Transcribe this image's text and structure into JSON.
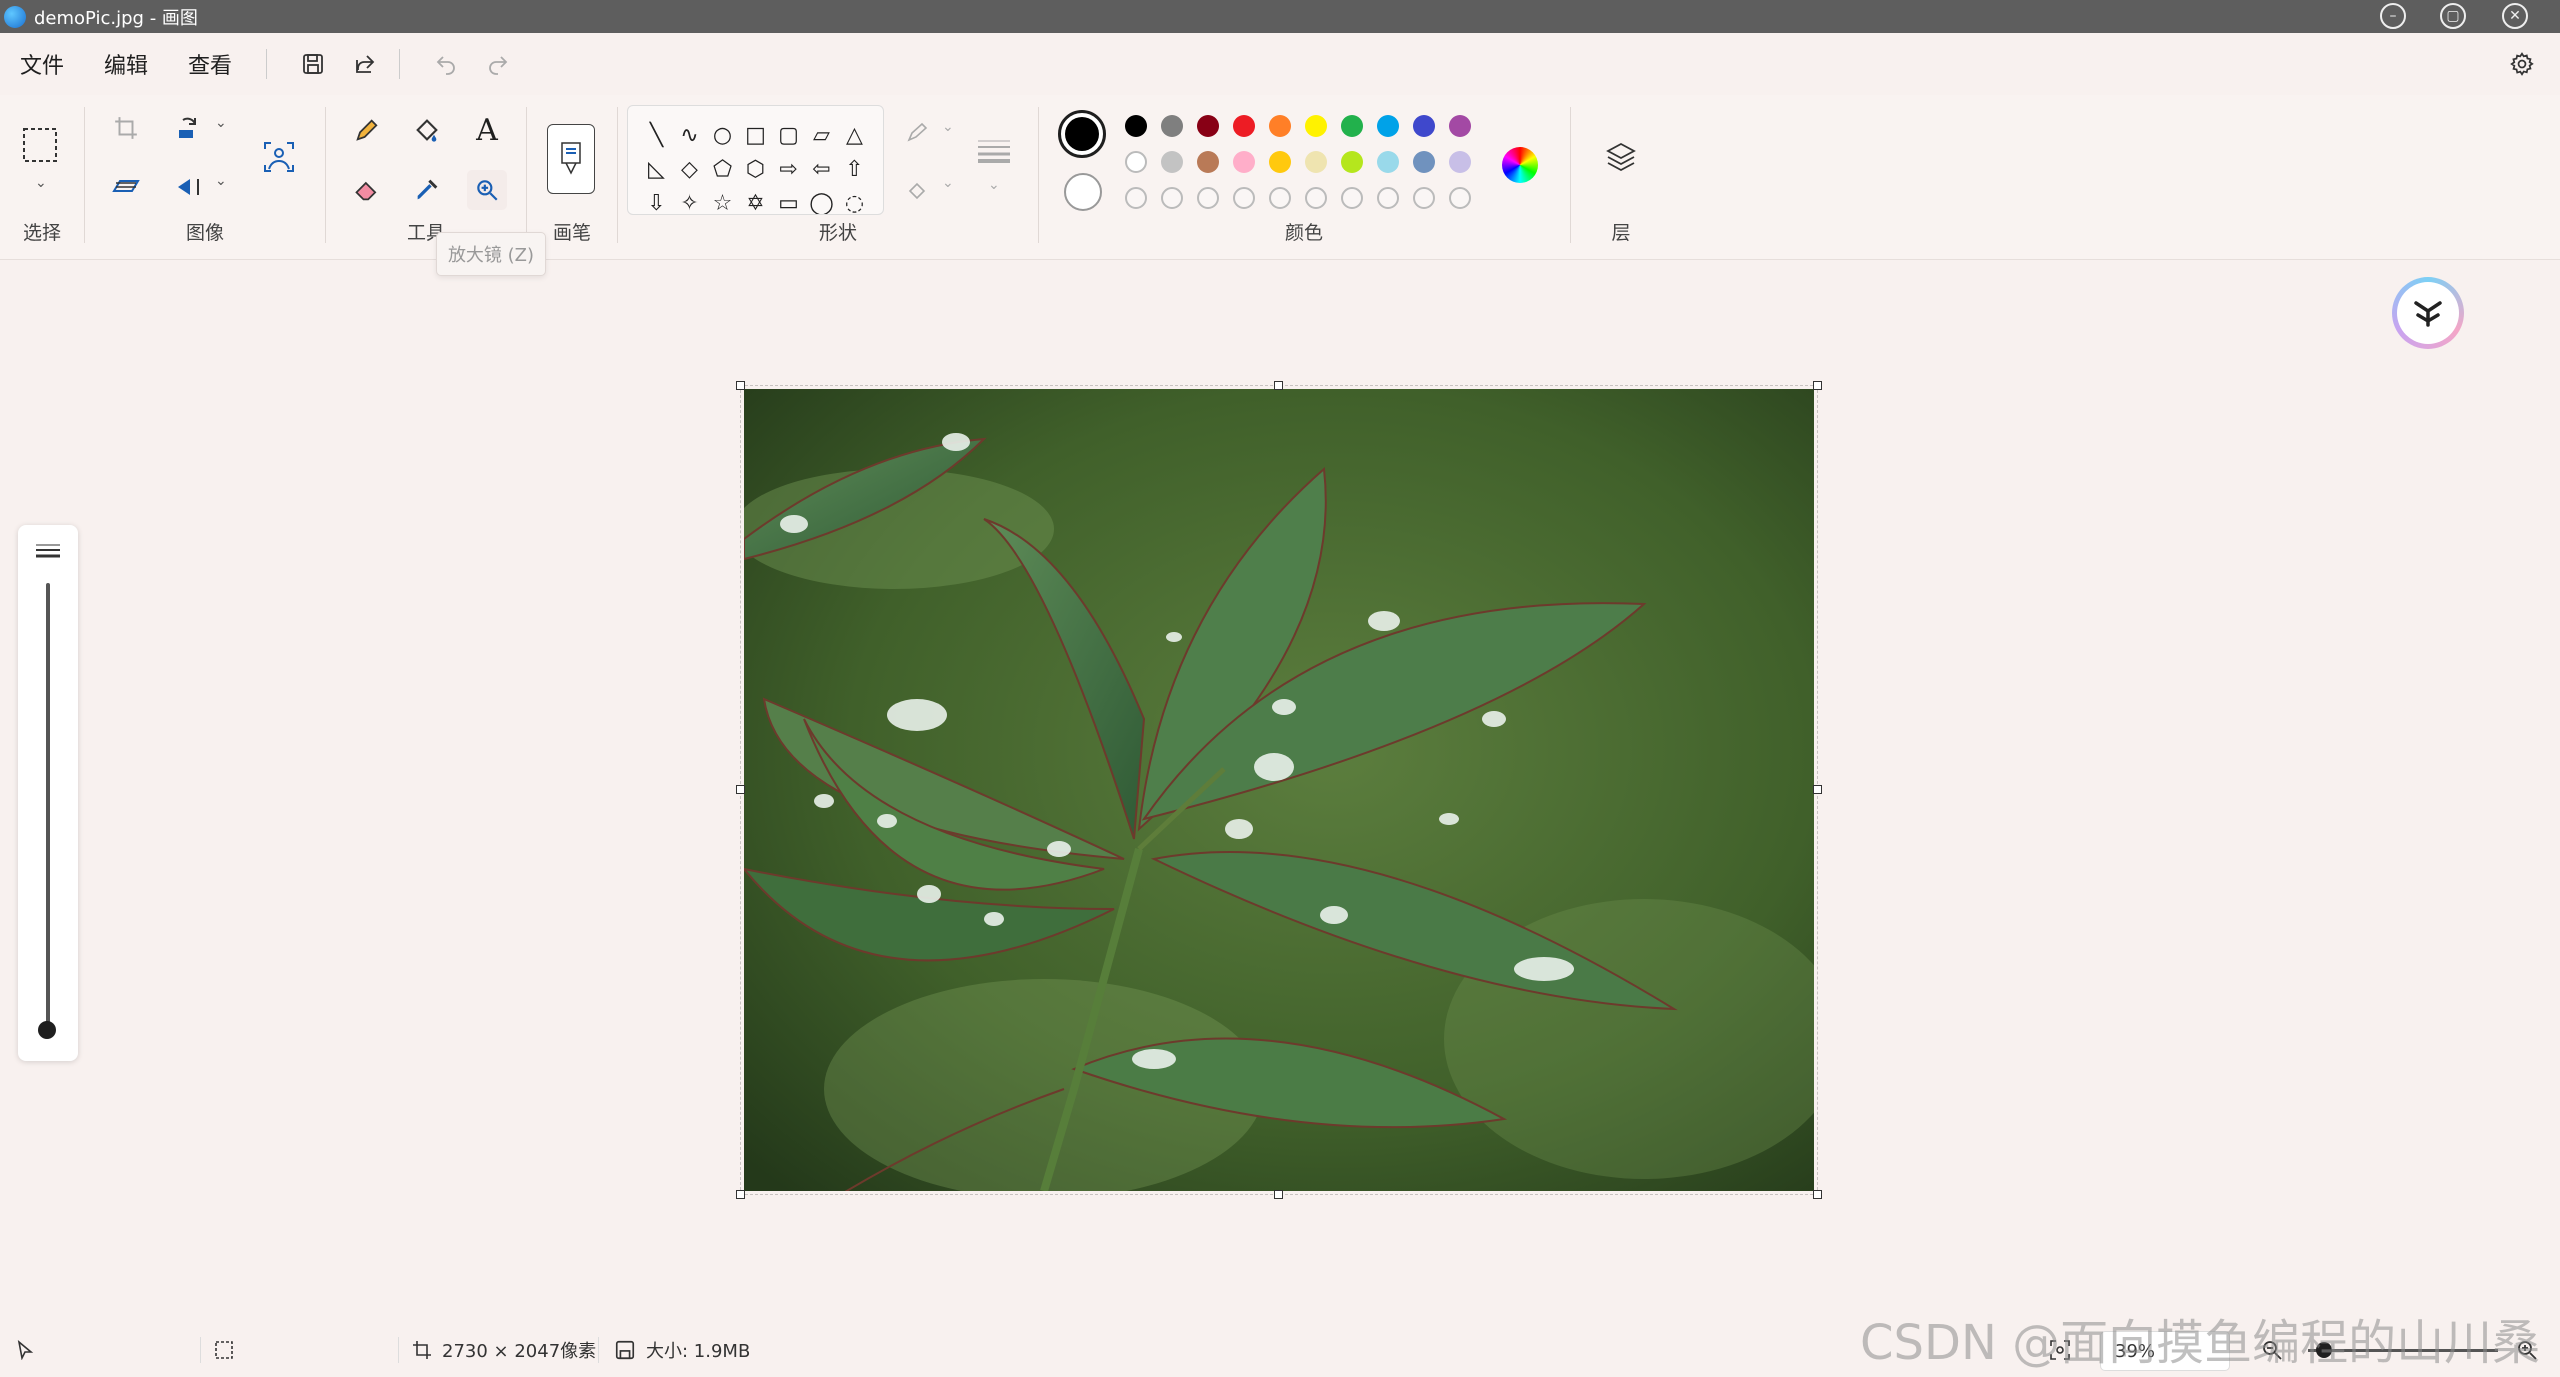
{
  "window": {
    "title": "demoPic.jpg - 画图",
    "controls": [
      "minimize-icon",
      "restore-icon",
      "close-icon"
    ]
  },
  "menu": {
    "items": [
      "文件",
      "编辑",
      "查看"
    ],
    "icons": [
      "save-icon",
      "share-icon",
      "undo-icon",
      "redo-icon"
    ],
    "settings_icon": "gear-icon"
  },
  "ribbon": {
    "groups": {
      "select": "选择",
      "image": "图像",
      "tools": "工具",
      "brush": "画笔",
      "shapes": "形状",
      "colors": "颜色",
      "layers": "层"
    },
    "tooltip": "放大镜 (Z)"
  },
  "colors": {
    "current_primary": "#000000",
    "current_secondary": "#ffffff",
    "row1": [
      "#000000",
      "#7f7f7f",
      "#880015",
      "#ed1c24",
      "#ff7f27",
      "#fff200",
      "#22b14c",
      "#00a2e8",
      "#3f48cc",
      "#a349a4"
    ],
    "row2": [
      "#ffffff",
      "#c3c3c3",
      "#b97a57",
      "#ffaec9",
      "#ffc90e",
      "#efe4b0",
      "#b5e61d",
      "#99d9ea",
      "#7092be",
      "#c8bfe7"
    ],
    "row3_custom_slots": 10
  },
  "canvas": {
    "image_name": "demoPic.jpg"
  },
  "status": {
    "dimensions": "2730 × 2047像素",
    "size": "大小: 1.9MB",
    "zoom": "39%"
  },
  "watermark": "CSDN @面向摸鱼编程的山川桑"
}
